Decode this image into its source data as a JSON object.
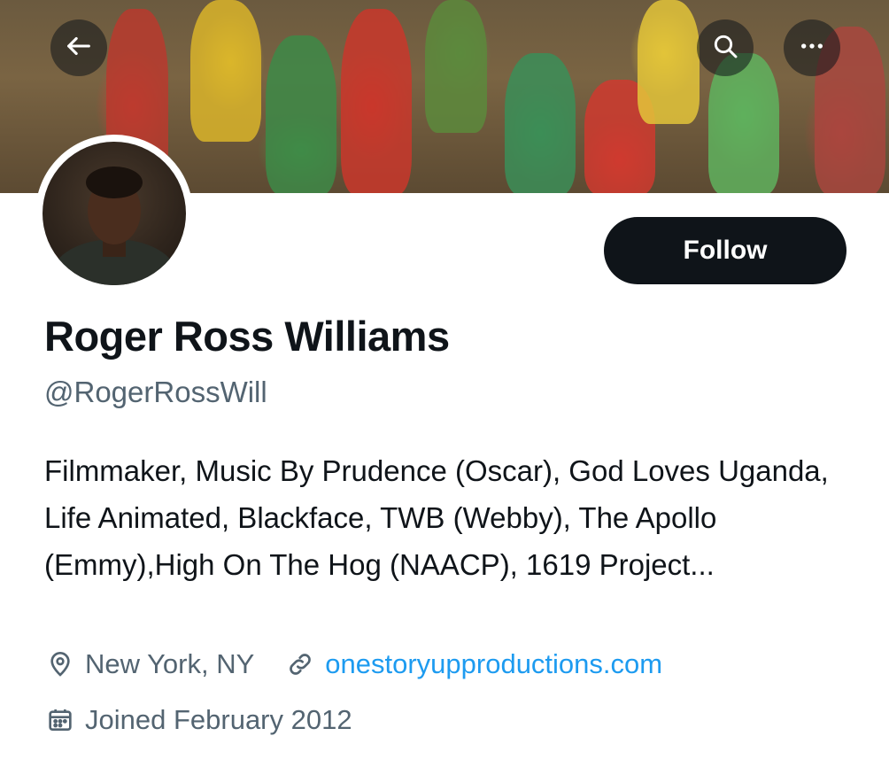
{
  "header": {
    "back_icon": "arrow-left-icon",
    "search_icon": "search-icon",
    "more_icon": "more-horizontal-icon"
  },
  "profile": {
    "name": "Roger Ross Williams",
    "handle": "@RogerRossWill",
    "follow_label": "Follow",
    "bio": "Filmmaker, Music By Prudence (Oscar), God Loves Uganda, Life Animated, Blackface, TWB (Webby), The Apollo (Emmy),High On The Hog (NAACP), 1619 Project...",
    "location": "New York, NY",
    "website": "onestoryupproductions.com",
    "joined": "Joined February 2012"
  },
  "colors": {
    "text": "#0f1419",
    "secondary": "#536471",
    "link": "#1d9bf0",
    "button_bg": "#0f1419"
  }
}
